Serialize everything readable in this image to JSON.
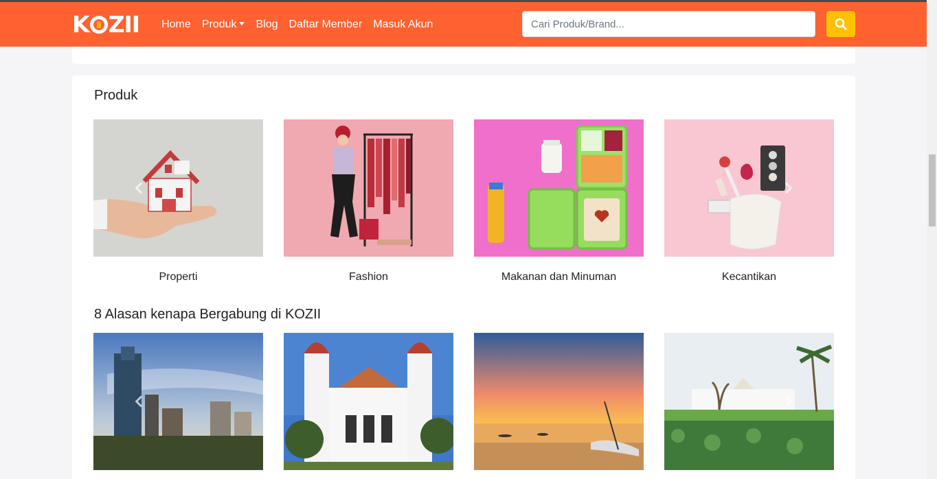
{
  "header": {
    "brand": "KOZII",
    "nav": {
      "home": "Home",
      "produk": "Produk",
      "blog": "Blog",
      "daftar": "Daftar Member",
      "masuk": "Masuk Akun"
    },
    "search": {
      "placeholder": "Cari Produk/Brand...",
      "icon": "search-icon"
    },
    "colors": {
      "navbar": "#ff6130",
      "search_button": "#ffc107"
    }
  },
  "produk": {
    "title": "Produk",
    "items": [
      {
        "label": "Properti"
      },
      {
        "label": "Fashion"
      },
      {
        "label": "Makanan dan Minuman"
      },
      {
        "label": "Kecantikan"
      }
    ]
  },
  "alasan": {
    "title": "8 Alasan kenapa Bergabung di KOZII"
  }
}
